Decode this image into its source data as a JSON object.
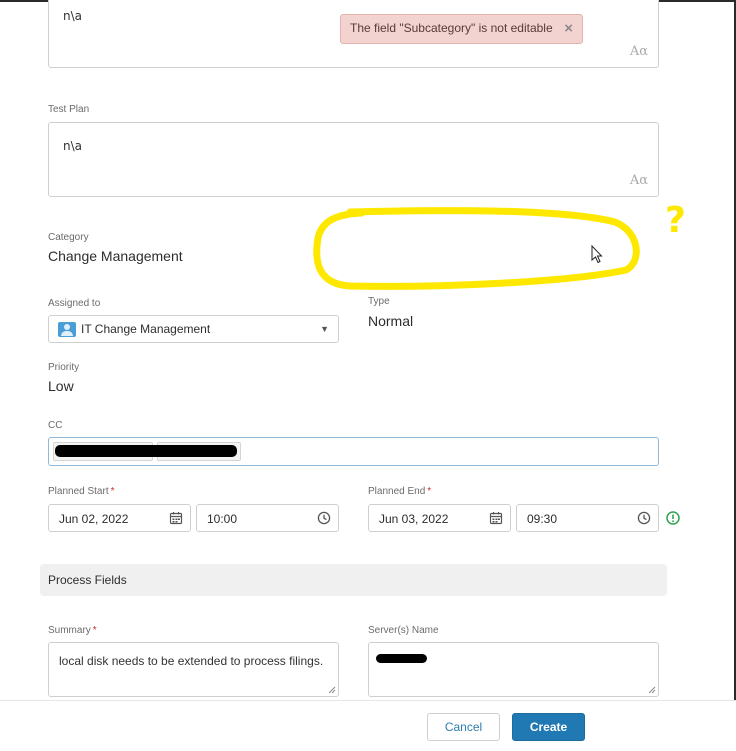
{
  "toast": {
    "message": "The field \"Subcategory\" is not editable",
    "close": "×"
  },
  "top_field": {
    "value": "n\\a",
    "format_icon": "Aα"
  },
  "test_plan": {
    "label": "Test Plan",
    "value": "n\\a",
    "format_icon": "Aα"
  },
  "category": {
    "label": "Category",
    "value": "Change Management"
  },
  "assigned_to": {
    "label": "Assigned to",
    "value": "IT Change Management",
    "icon": "group-icon",
    "caret": "▼"
  },
  "type": {
    "label": "Type",
    "value": "Normal"
  },
  "priority": {
    "label": "Priority",
    "value": "Low"
  },
  "cc": {
    "label": "CC"
  },
  "planned_start": {
    "label": "Planned Start",
    "required": "*",
    "date": "Jun 02, 2022",
    "time": "10:00"
  },
  "planned_end": {
    "label": "Planned End",
    "required": "*",
    "date": "Jun 03, 2022",
    "time": "09:30"
  },
  "process_fields": {
    "title": "Process Fields"
  },
  "summary": {
    "label": "Summary",
    "required": "*",
    "value": "local disk needs to be extended to process filings."
  },
  "servers": {
    "label": "Server(s) Name"
  },
  "buttons": {
    "cancel": "Cancel",
    "create": "Create"
  },
  "annotation": {
    "mark": "?"
  },
  "colors": {
    "accent": "#2179b3",
    "toast_bg": "#f2d3d0",
    "required": "#c9302c",
    "annotation": "#ffe800",
    "warning": "#2ea44f"
  }
}
